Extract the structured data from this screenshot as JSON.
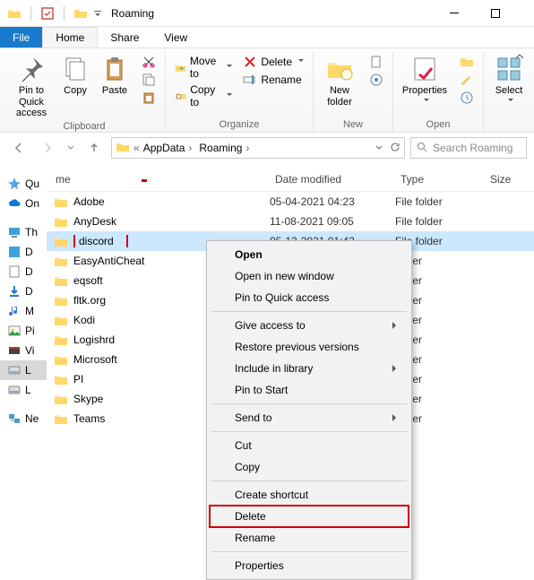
{
  "title": "Roaming",
  "menu": {
    "file": "File",
    "home": "Home",
    "share": "Share",
    "view": "View"
  },
  "ribbon": {
    "pin": "Pin to Quick\naccess",
    "copy": "Copy",
    "paste": "Paste",
    "moveto": "Move to",
    "copyto": "Copy to",
    "delete": "Delete",
    "rename": "Rename",
    "newfolder": "New\nfolder",
    "properties": "Properties",
    "select": "Select",
    "g_clipboard": "Clipboard",
    "g_organize": "Organize",
    "g_new": "New",
    "g_open": "Open"
  },
  "breadcrumbs": [
    "AppData",
    "Roaming"
  ],
  "search_placeholder": "Search Roaming",
  "columns": {
    "name": "me",
    "date": "Date modified",
    "type": "Type",
    "size": "Size"
  },
  "folder_type": "File folder",
  "rows": [
    {
      "n": "Adobe",
      "d": "05-04-2021 04:23"
    },
    {
      "n": "AnyDesk",
      "d": "11-08-2021 09:05"
    },
    {
      "n": "discord",
      "d": "05-12-2021 01:42",
      "sel": true,
      "box": true
    },
    {
      "n": "EasyAntiCheat",
      "d": ""
    },
    {
      "n": "eqsoft",
      "d": ""
    },
    {
      "n": "fltk.org",
      "d": ""
    },
    {
      "n": "Kodi",
      "d": ""
    },
    {
      "n": "Logishrd",
      "d": ""
    },
    {
      "n": "Microsoft",
      "d": ""
    },
    {
      "n": "PI",
      "d": ""
    },
    {
      "n": "Skype",
      "d": ""
    },
    {
      "n": "Teams",
      "d": ""
    }
  ],
  "sidebar": [
    {
      "label": "Qu",
      "icon": "star",
      "color": "#2e77d0"
    },
    {
      "label": "On",
      "icon": "cloud",
      "color": "#0a66c2"
    },
    {
      "spacer": true
    },
    {
      "label": "Th",
      "icon": "pc",
      "color": "#3ea1da"
    },
    {
      "label": "D",
      "icon": "square",
      "color": "#3ea1da"
    },
    {
      "label": "D",
      "icon": "doc",
      "color": "#6c6c6c"
    },
    {
      "label": "D",
      "icon": "down",
      "color": "#2e77d0"
    },
    {
      "label": "M",
      "icon": "music",
      "color": "#2e77d0"
    },
    {
      "label": "Pi",
      "icon": "pic",
      "color": "#2e9f4e"
    },
    {
      "label": "Vi",
      "icon": "video",
      "color": "#c0392b"
    },
    {
      "label": "L",
      "icon": "disk",
      "color": "#888",
      "sel": true
    },
    {
      "label": "L",
      "icon": "disk",
      "color": "#888"
    },
    {
      "spacer": true
    },
    {
      "label": "Ne",
      "icon": "net",
      "color": "#2e77d0"
    }
  ],
  "ctx": {
    "open": "Open",
    "openwin": "Open in new window",
    "pin": "Pin to Quick access",
    "give": "Give access to",
    "restore": "Restore previous versions",
    "incl": "Include in library",
    "pinstart": "Pin to Start",
    "sendto": "Send to",
    "cut": "Cut",
    "copy": "Copy",
    "shortcut": "Create shortcut",
    "delete": "Delete",
    "rename": "Rename",
    "props": "Properties"
  }
}
